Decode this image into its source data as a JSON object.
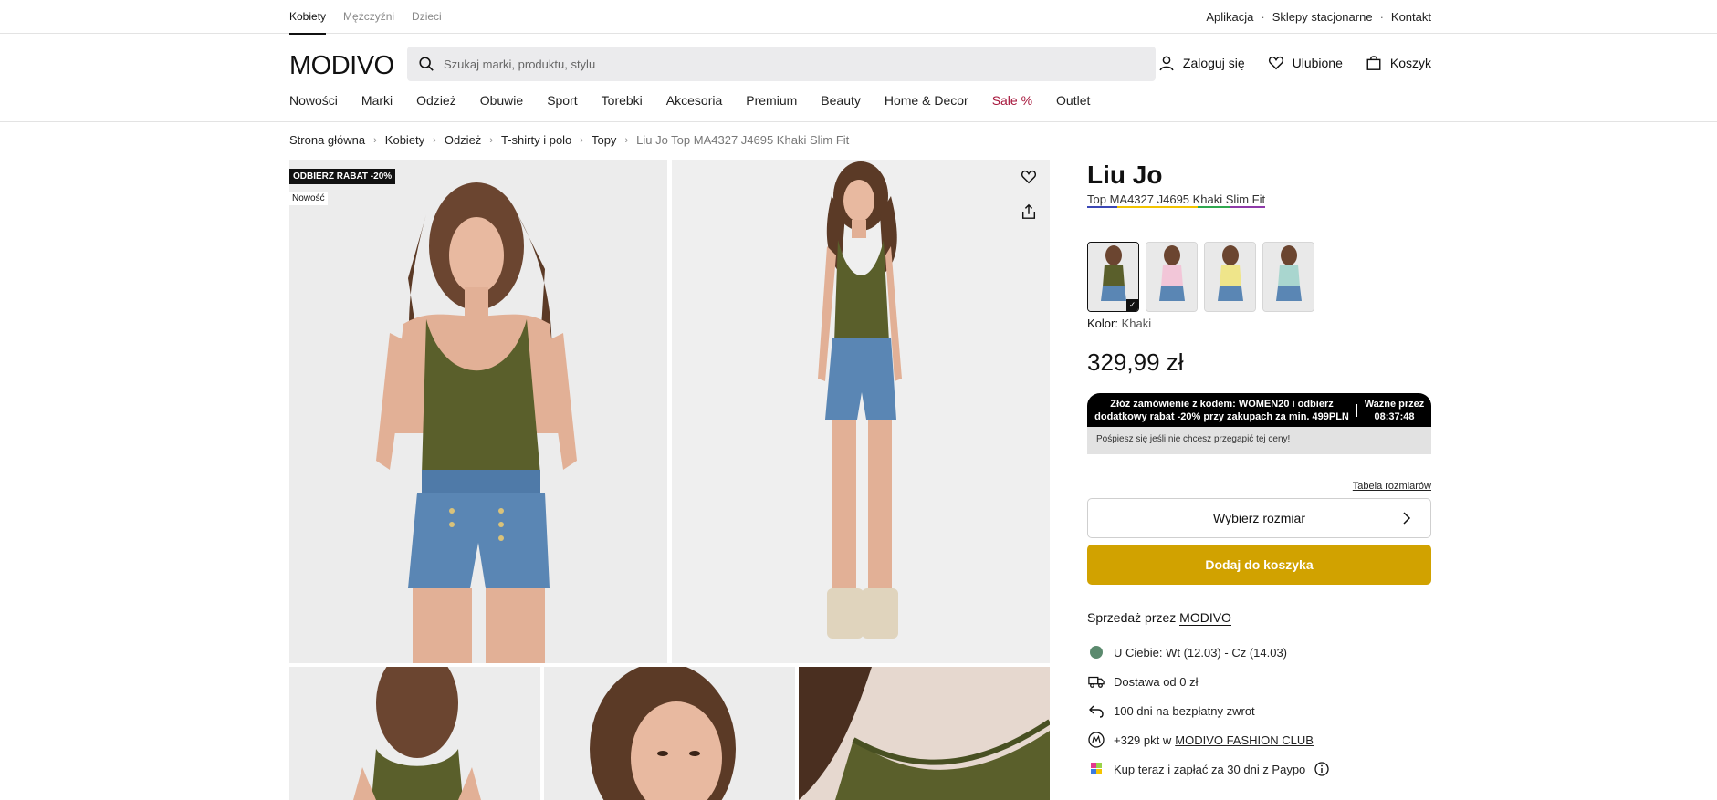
{
  "gender_tabs": [
    {
      "label": "Kobiety",
      "active": true
    },
    {
      "label": "Mężczyźni",
      "active": false
    },
    {
      "label": "Dzieci",
      "active": false
    }
  ],
  "top_links": [
    "Aplikacja",
    "Sklepy stacjonarne",
    "Kontakt"
  ],
  "logo": "MODIVO",
  "search": {
    "placeholder": "Szukaj marki, produktu, stylu",
    "icon": "search-icon"
  },
  "user_actions": {
    "login": "Zaloguj się",
    "favorites": "Ulubione",
    "cart": "Koszyk"
  },
  "nav": [
    "Nowości",
    "Marki",
    "Odzież",
    "Obuwie",
    "Sport",
    "Torebki",
    "Akcesoria",
    "Premium",
    "Beauty",
    "Home & Decor",
    "Sale %",
    "Outlet"
  ],
  "breadcrumb": [
    "Strona główna",
    "Kobiety",
    "Odzież",
    "T-shirty i polo",
    "Topy",
    "Liu Jo Top MA4327 J4695 Khaki Slim Fit"
  ],
  "gallery": {
    "badge_discount": "ODBIERZ RABAT -20%",
    "badge_new": "Nowość"
  },
  "product": {
    "brand": "Liu Jo",
    "name": "Top MA4327 J4695 Khaki Slim Fit",
    "color_label": "Kolor:",
    "color_value": "Khaki",
    "price": "329,99 zł",
    "swatch_colors": [
      "#5a5f2b",
      "#f2c6d8",
      "#efe58a",
      "#a9d6cf"
    ]
  },
  "promo": {
    "message_line1": "Złóż zamówienie z kodem: WOMEN20 i odbierz",
    "message_line2": "dodatkowy rabat -20% przy zakupach za min. 499PLN",
    "timer_label": "Ważne przez",
    "timer_value": "08:37:48",
    "hint": "Pośpiesz się jeśli nie chcesz przegapić tej ceny!"
  },
  "size": {
    "table_link": "Tabela rozmiarów",
    "select_label": "Wybierz rozmiar"
  },
  "add_to_cart": "Dodaj do koszyka",
  "sold_by": {
    "label": "Sprzedaż przez",
    "seller": "MODIVO"
  },
  "info": {
    "delivery_date": "U Ciebie: Wt (12.03) - Cz (14.03)",
    "shipping": "Dostawa od 0 zł",
    "returns": "100 dni na bezpłatny zwrot",
    "points_prefix": "+329 pkt w",
    "points_club": "MODIVO FASHION CLUB",
    "paypo": "Kup teraz i zapłać za 30 dni z Paypo"
  }
}
